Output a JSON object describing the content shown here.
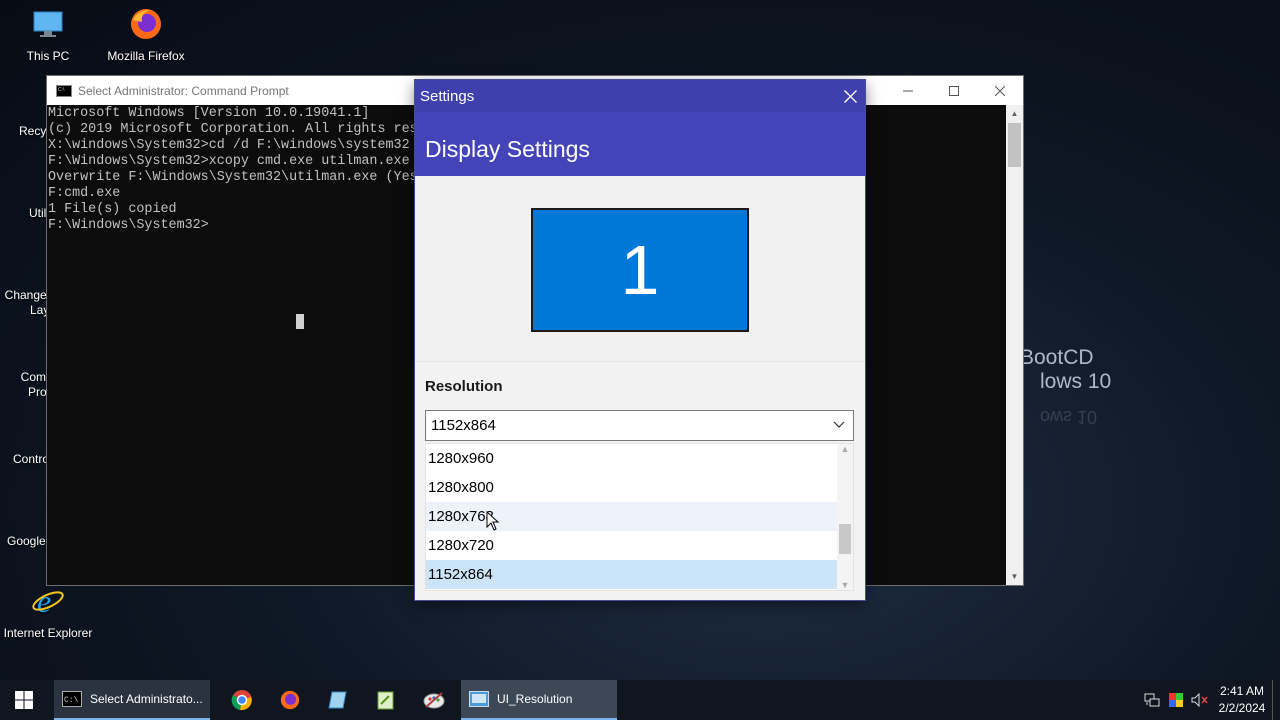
{
  "desktop": {
    "icons": [
      {
        "label": "This PC"
      },
      {
        "label": "Mozilla Firefox"
      },
      {
        "label": "Internet Explorer"
      }
    ],
    "partial_labels": [
      "Recyc",
      "Util",
      "Change",
      "Lay",
      "Com",
      "Pro",
      "Contro",
      "Google"
    ],
    "wallpaper_text": [
      "BootCD",
      "lows 10"
    ]
  },
  "cmd_window": {
    "title": "Select Administrator: Command Prompt",
    "lines": [
      "Microsoft Windows [Version 10.0.19041.1]",
      "(c) 2019 Microsoft Corporation. All rights res",
      "",
      "X:\\windows\\System32>cd /d F:\\windows\\system32",
      "",
      "F:\\Windows\\System32>xcopy cmd.exe utilman.exe",
      "Overwrite F:\\Windows\\System32\\utilman.exe (Yes",
      "F:cmd.exe",
      "1 File(s) copied",
      "",
      "F:\\Windows\\System32>"
    ]
  },
  "settings_window": {
    "title": "Settings",
    "header": "Display Settings",
    "monitor_number": "1",
    "resolution_label": "Resolution",
    "selected_resolution": "1152x864",
    "options": [
      "1280x960",
      "1280x800",
      "1280x768",
      "1280x720",
      "1152x864"
    ],
    "hover_index": 2,
    "selected_index": 4
  },
  "taskbar": {
    "items": [
      {
        "label": "Select Administrato..."
      },
      {
        "label": "UI_Resolution"
      }
    ],
    "clock": {
      "time": "2:41 AM",
      "date": "2/2/2024"
    }
  },
  "colors": {
    "settings_titlebar": "#3f3fae",
    "settings_header": "#4444b8",
    "monitor": "#0078d7",
    "selected_option": "#cce4f7"
  }
}
